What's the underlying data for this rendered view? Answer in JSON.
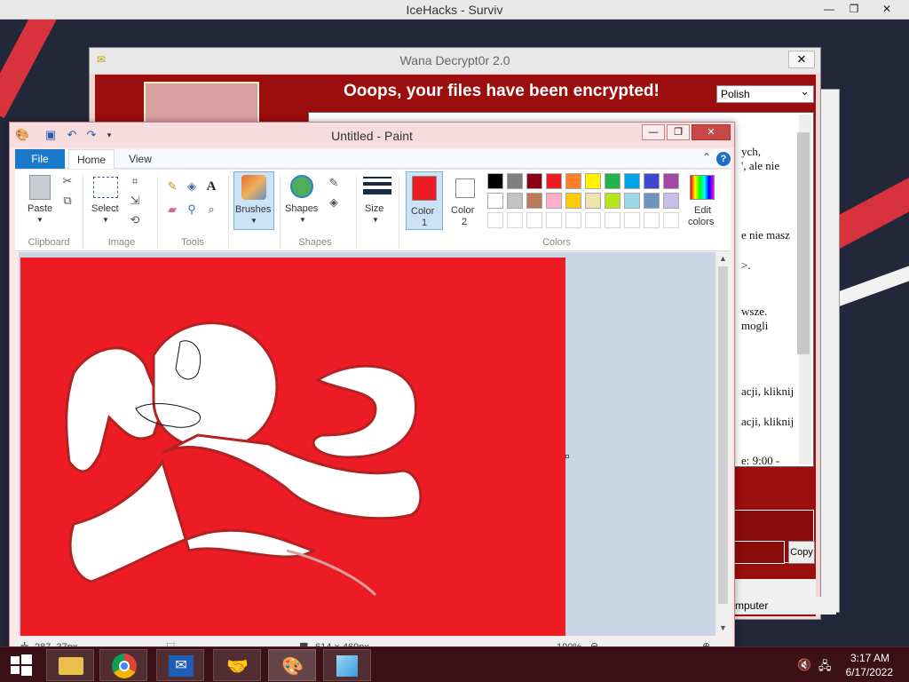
{
  "outer_window": {
    "title": "IceHacks - Surviv"
  },
  "wana": {
    "title": "Wana Decrypt0r 2.0",
    "heading": "Ooops, your files have been encrypted!",
    "language": "Polish",
    "text_fragments": [
      "ych,",
      "', ale nie",
      "e nie masz",
      ">.",
      "wsze.",
      "mogli",
      "acji, kliknij",
      "acji, kliknij",
      "e: 9:00 -"
    ],
    "copy_label": "Copy"
  },
  "status_text": "mputer",
  "paint": {
    "title": "Untitled - Paint",
    "tabs": {
      "file": "File",
      "home": "Home",
      "view": "View"
    },
    "clipboard": {
      "paste": "Paste",
      "label": "Clipboard"
    },
    "image": {
      "select": "Select",
      "label": "Image"
    },
    "tools": {
      "label": "Tools",
      "text_tool": "A"
    },
    "brushes": {
      "label": "Brushes"
    },
    "shapes": {
      "button": "Shapes",
      "label": "Shapes"
    },
    "size": {
      "label": "Size"
    },
    "color1": {
      "line1": "Color",
      "line2": "1",
      "value": "#ed1c24"
    },
    "color2": {
      "line1": "Color",
      "line2": "2",
      "value": "#ffffff"
    },
    "colors_label": "Colors",
    "edit_colors": {
      "line1": "Edit",
      "line2": "colors"
    },
    "palette_row1": [
      "#000000",
      "#7f7f7f",
      "#880015",
      "#ed1c24",
      "#ff7f27",
      "#fff200",
      "#22b14c",
      "#00a2e8",
      "#3f48cc",
      "#a349a4"
    ],
    "palette_row2": [
      "#ffffff",
      "#c3c3c3",
      "#b97a57",
      "#ffaec9",
      "#ffc90e",
      "#efe4b0",
      "#b5e61d",
      "#99d9ea",
      "#7092be",
      "#c8bfe7"
    ],
    "canvas_bg": "#ed1c24",
    "status": {
      "cursor": "287, 37px",
      "size": "614 × 469px",
      "zoom": "100%"
    }
  },
  "taskbar": {
    "time": "3:17 AM",
    "date": "6/17/2022"
  }
}
